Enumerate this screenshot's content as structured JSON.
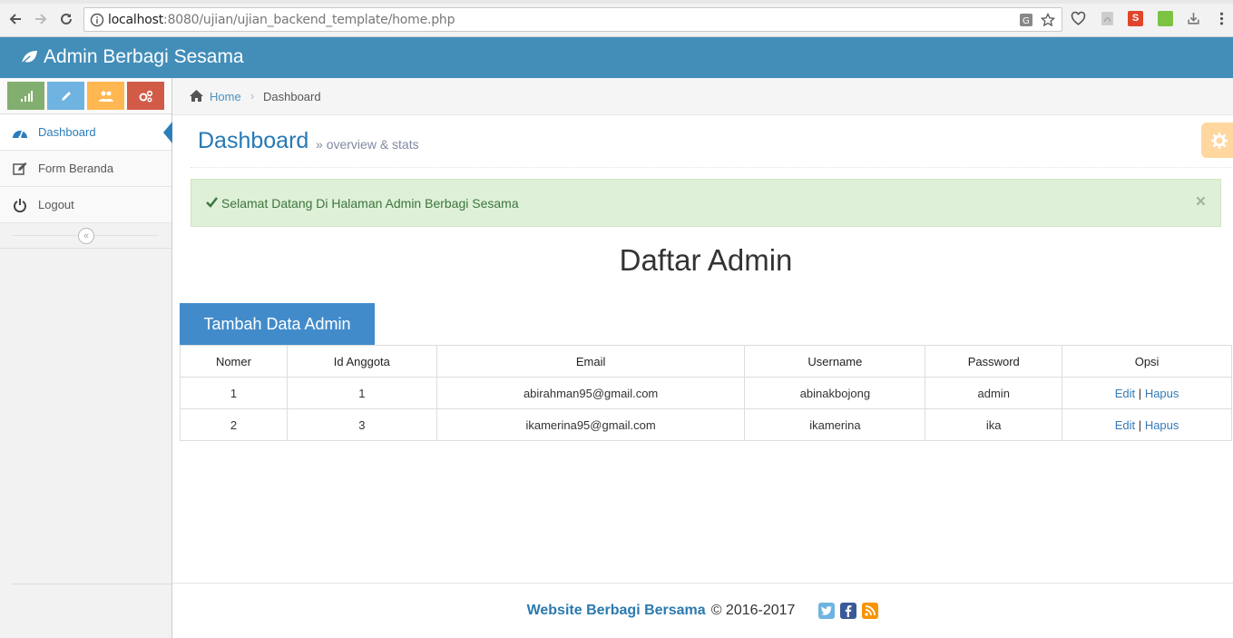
{
  "browser": {
    "url_host": "localhost",
    "url_rest": ":8080/ujian/ujian_backend_template/home.php"
  },
  "app": {
    "brand": "Admin Berbagi Sesama"
  },
  "sidebar": {
    "shortcuts": [
      {
        "icon": "signal-icon",
        "color": "#82af6f"
      },
      {
        "icon": "pencil-icon",
        "color": "#6fb3e0"
      },
      {
        "icon": "users-icon",
        "color": "#ffb752"
      },
      {
        "icon": "cogs-icon",
        "color": "#d15b47"
      }
    ],
    "items": [
      {
        "label": "Dashboard",
        "icon": "dashboard-icon",
        "active": true
      },
      {
        "label": "Form Beranda",
        "icon": "edit-icon",
        "active": false
      },
      {
        "label": "Logout",
        "icon": "power-icon",
        "active": false
      }
    ]
  },
  "breadcrumb": {
    "home": "Home",
    "current": "Dashboard"
  },
  "page": {
    "title": "Dashboard",
    "subtitle": "overview & stats"
  },
  "alert": {
    "text": "Selamat Datang Di Halaman Admin Berbagi Sesama",
    "close": "×"
  },
  "content": {
    "title": "Daftar Admin",
    "add_button": "Tambah Data Admin",
    "table": {
      "headers": [
        "Nomer",
        "Id Anggota",
        "Email",
        "Username",
        "Password",
        "Opsi"
      ],
      "rows": [
        {
          "nomer": "1",
          "id_anggota": "1",
          "email": "abirahman95@gmail.com",
          "username": "abinakbojong",
          "password": "admin",
          "edit": "Edit",
          "sep": "|",
          "hapus": "Hapus"
        },
        {
          "nomer": "2",
          "id_anggota": "3",
          "email": "ikamerina95@gmail.com",
          "username": "ikamerina",
          "password": "ika",
          "edit": "Edit",
          "sep": "|",
          "hapus": "Hapus"
        }
      ]
    }
  },
  "footer": {
    "site": "Website Berbagi Bersama",
    "copyright": "© 2016-2017"
  },
  "colors": {
    "header": "#438eb9",
    "accent": "#2b7dbc",
    "alert_bg": "#dff0d8",
    "button": "#428bca"
  }
}
